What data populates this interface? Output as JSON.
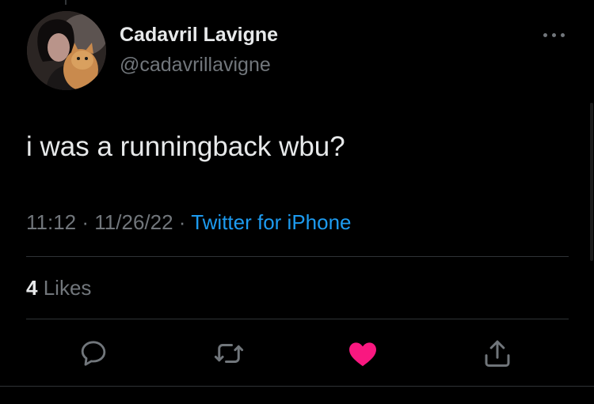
{
  "tweet": {
    "display_name": "Cadavril Lavigne",
    "handle": "@cadavrillavigne",
    "text": "i was a runningback wbu?",
    "time": "11:12",
    "date": "11/26/22",
    "source": "Twitter for iPhone",
    "likes_count": "4",
    "likes_label": "Likes"
  },
  "icons": {
    "more": "more-dots-icon",
    "reply": "reply-icon",
    "retweet": "retweet-icon",
    "like": "heart-icon",
    "share": "share-icon"
  },
  "colors": {
    "background": "#000000",
    "text_primary": "#e7e9ea",
    "text_secondary": "#71767b",
    "link": "#1d9bf0",
    "like_active": "#f91880",
    "divider": "#2f3336"
  }
}
